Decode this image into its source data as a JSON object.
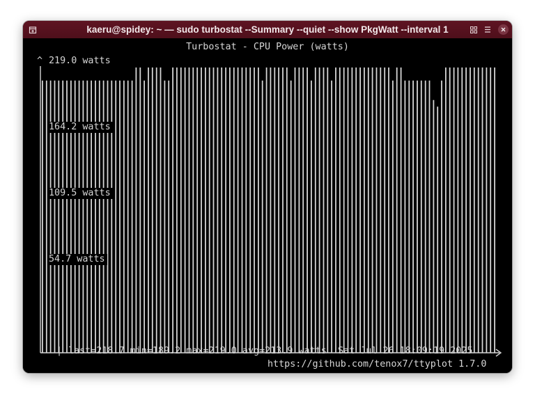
{
  "window": {
    "title": "kaeru@spidey: ~ — sudo turbostat --Summary --quiet --show PkgWatt --interval 1",
    "colors": {
      "titlebar": "#58121f",
      "terminal_bg": "#000000",
      "text": "#d6d6d6"
    },
    "icons": {
      "left": "new-tab-icon",
      "grid": "view-grid-icon",
      "menu": "hamburger-menu-icon",
      "close": "close-icon"
    }
  },
  "terminal": {
    "plot_title": "Turbostat - CPU Power (watts)",
    "axis_arrow_top": "^",
    "y_labels": [
      "219.0 watts",
      "164.2 watts",
      "109.5 watts",
      "54.7 watts"
    ],
    "stats_marker": "|",
    "stats": "last=218.7 min=189.2 max=219.0 avg=213.9 watts  Sat Jul 26 18:09:19 2025",
    "footer": "https://github.com/tenox7/ttyplot 1.7.0"
  },
  "chart_data": {
    "type": "bar",
    "title": "Turbostat - CPU Power (watts)",
    "ylabel": "watts",
    "ylim": [
      0,
      219.0
    ],
    "yticks": [
      219.0,
      164.2,
      109.5,
      54.7
    ],
    "values": [
      209,
      209,
      209,
      209,
      209,
      209,
      209,
      209,
      209,
      209,
      209,
      209,
      209,
      209,
      209,
      209,
      209,
      209,
      209,
      209,
      209,
      209,
      209,
      219,
      219,
      209,
      219,
      219,
      219,
      219,
      209,
      209,
      219,
      219,
      219,
      219,
      219,
      219,
      219,
      219,
      219,
      219,
      219,
      219,
      219,
      219,
      219,
      219,
      219,
      219,
      219,
      219,
      219,
      219,
      209,
      219,
      219,
      219,
      219,
      219,
      219,
      209,
      219,
      219,
      219,
      219,
      209,
      219,
      219,
      219,
      219,
      209,
      219,
      219,
      219,
      219,
      219,
      219,
      219,
      219,
      219,
      219,
      219,
      219,
      219,
      219,
      209,
      219,
      219,
      209,
      209,
      209,
      209,
      209,
      209,
      209,
      194,
      189,
      209,
      219,
      219,
      219,
      219,
      219,
      219,
      219,
      219,
      219,
      219,
      219,
      219,
      219
    ]
  }
}
